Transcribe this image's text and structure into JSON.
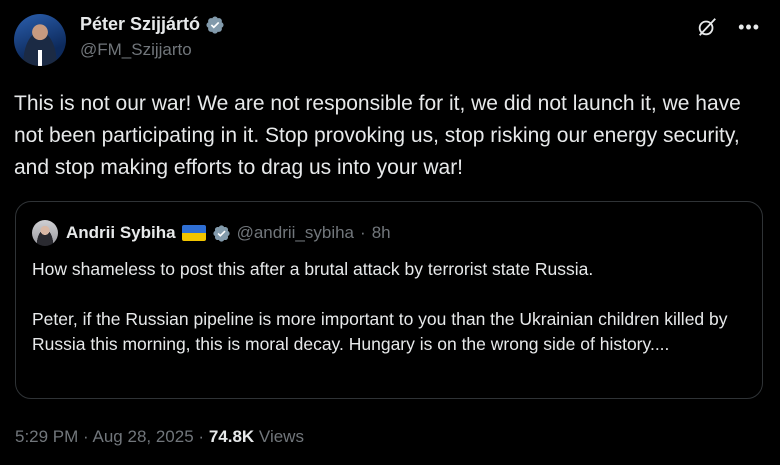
{
  "author": {
    "name": "Péter Szijjártó",
    "handle": "@FM_Szijjarto"
  },
  "tweet": {
    "text": "This is not our war! We are not responsible for it, we did not launch it, we have not been participating in it. Stop provoking us, stop risking our energy security, and stop making efforts to drag us into your war!"
  },
  "quote": {
    "name": "Andrii Sybiha",
    "handle": "@andrii_sybiha",
    "separator": "·",
    "time": "8h",
    "paragraph1": "How shameless to post this after a brutal attack by terrorist state Russia.",
    "paragraph2": "Peter, if the Russian pipeline is more important to you than the Ukrainian children killed by Russia this morning, this is moral decay. Hungary is on the wrong side of history...."
  },
  "meta": {
    "time": "5:29 PM",
    "sep1": "·",
    "date": "Aug 28, 2025",
    "sep2": "·",
    "views_count": "74.8K",
    "views_label": "Views"
  },
  "icons": {
    "verified": "verified-badge-icon",
    "grok": "grok-icon",
    "more": "more-icon",
    "flag": "ukraine-flag-icon"
  },
  "colors": {
    "background": "#000000",
    "text": "#e7e9ea",
    "secondary": "#71767b",
    "border": "#2f3336",
    "verified_gray": "#829aab"
  }
}
